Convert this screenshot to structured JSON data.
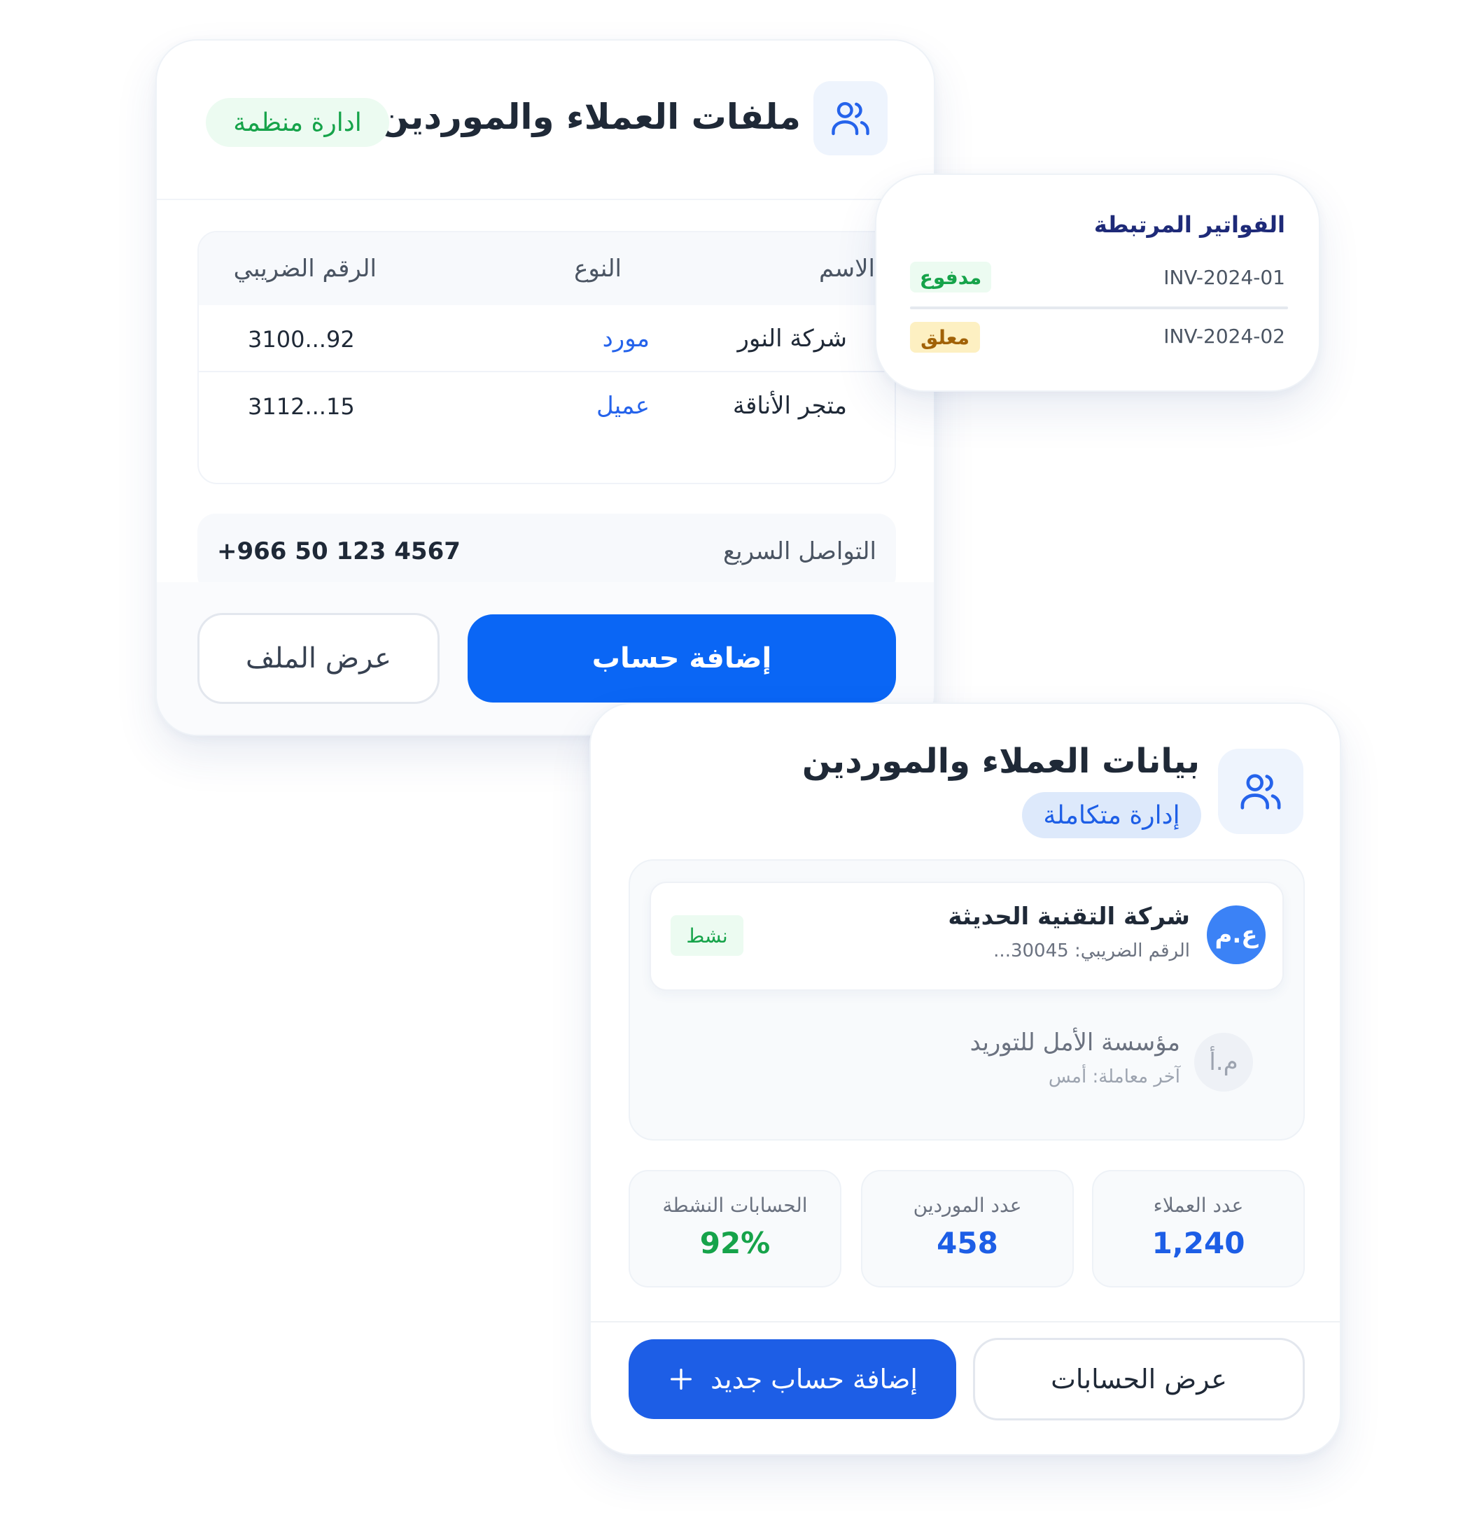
{
  "colors": {
    "primary": "#0a66f5",
    "primary_dark": "#1d5ee6",
    "green": "#16a34a",
    "green_bg": "#ecfbf1",
    "amber": "#a16207",
    "amber_bg": "#fdf0c2",
    "blue_badge_bg": "#dde9fb",
    "navy": "#1e2a78"
  },
  "profiles_card": {
    "icon": "users-icon",
    "title": "ملفات العملاء والموردين",
    "badge": "ادارة منظمة",
    "table": {
      "headers": {
        "name": "الاسم",
        "type": "النوع",
        "tax": "الرقم الضريبي"
      },
      "rows": [
        {
          "name": "شركة النور",
          "type": "مورد",
          "tax": "3100...92"
        },
        {
          "name": "متجر الأناقة",
          "type": "عميل",
          "tax": "3112...15"
        }
      ]
    },
    "contact": {
      "label": "التواصل السريع",
      "phone": "+966 50 123 4567"
    },
    "buttons": {
      "add": "إضافة حساب",
      "view": "عرض الملف"
    }
  },
  "invoices_card": {
    "title": "الفواتير المرتبطة",
    "items": [
      {
        "id": "INV-2024-01",
        "status": "مدفوع"
      },
      {
        "id": "INV-2024-02",
        "status": "معلق"
      }
    ]
  },
  "data_card": {
    "icon": "users-icon",
    "title": "بيانات العملاء والموردين",
    "badge": "إدارة متكاملة",
    "accounts": [
      {
        "initials": "ع.م",
        "name": "شركة التقنية الحديثة",
        "meta": "الرقم الضريبي: 30045...",
        "status": "نشط"
      },
      {
        "initials": "م.أ",
        "name": "مؤسسة الأمل للتوريد",
        "meta": "آخر معاملة: أمس"
      }
    ],
    "stats": [
      {
        "label": "عدد العملاء",
        "value": "1,240"
      },
      {
        "label": "عدد الموردين",
        "value": "458"
      },
      {
        "label": "الحسابات النشطة",
        "value": "92%"
      }
    ],
    "buttons": {
      "view": "عرض الحسابات",
      "add": "إضافة حساب جديد",
      "add_icon": "plus-icon"
    }
  }
}
